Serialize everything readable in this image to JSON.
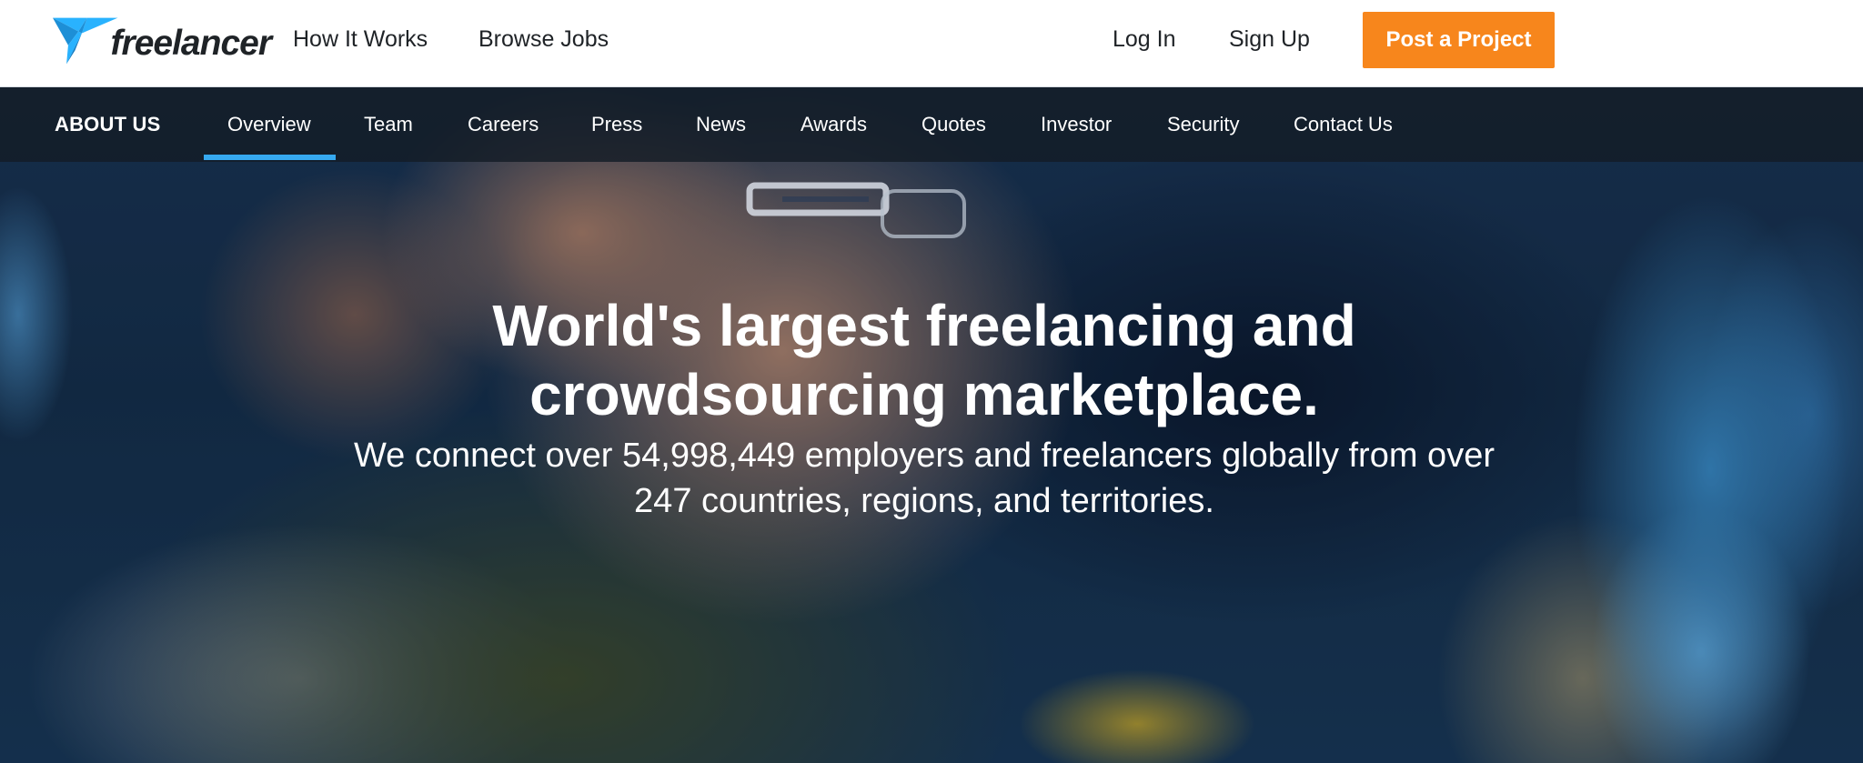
{
  "topbar": {
    "logo_text": "freelancer",
    "nav": [
      {
        "label": "How It Works"
      },
      {
        "label": "Browse Jobs"
      }
    ],
    "login_label": "Log In",
    "signup_label": "Sign Up",
    "post_project_label": "Post a Project",
    "accent_color": "#f7861c",
    "brand_color": "#29b2fe"
  },
  "subnav": {
    "title": "ABOUT US",
    "active_tab": "Overview",
    "underline_color": "#36a9f0",
    "items": [
      {
        "label": "Overview"
      },
      {
        "label": "Team"
      },
      {
        "label": "Careers"
      },
      {
        "label": "Press"
      },
      {
        "label": "News"
      },
      {
        "label": "Awards"
      },
      {
        "label": "Quotes"
      },
      {
        "label": "Investor"
      },
      {
        "label": "Security"
      },
      {
        "label": "Contact Us"
      }
    ]
  },
  "hero": {
    "title_line1": "World's largest freelancing and",
    "title_line2": "crowdsourcing marketplace.",
    "subtitle_line1": "We connect over 54,998,449 employers and freelancers globally from over",
    "subtitle_line2": "247 countries, regions, and territories."
  }
}
